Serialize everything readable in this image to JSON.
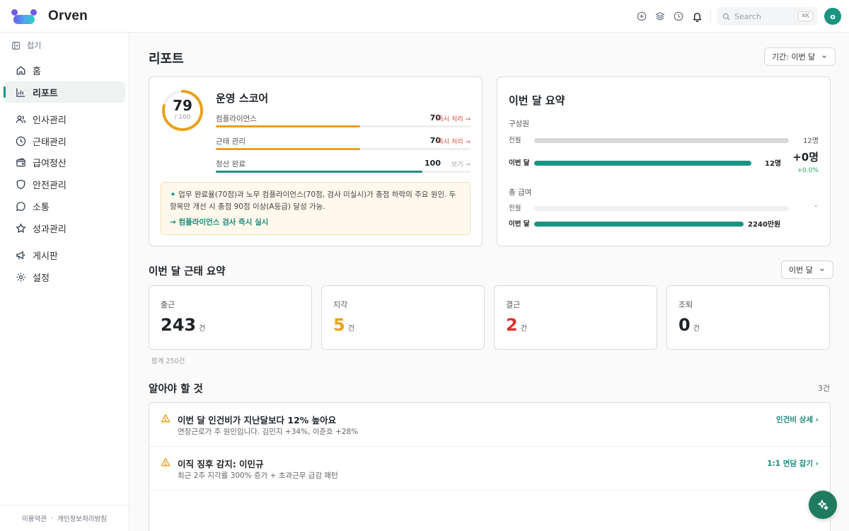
{
  "app": {
    "name": "Orven"
  },
  "topbar": {
    "search_placeholder": "Search",
    "search_shortcut": "⌘K",
    "avatar_initial": "o"
  },
  "sidebar": {
    "collapse_label": "접기",
    "items": [
      {
        "label": "홈",
        "icon": "home-icon"
      },
      {
        "label": "리포트",
        "icon": "bar-chart-icon",
        "active": true
      },
      {
        "label": "인사관리",
        "icon": "users-icon"
      },
      {
        "label": "근태관리",
        "icon": "clock-icon"
      },
      {
        "label": "급여정산",
        "icon": "wallet-icon"
      },
      {
        "label": "안전관리",
        "icon": "shield-icon"
      },
      {
        "label": "소통",
        "icon": "chat-icon"
      },
      {
        "label": "성과관리",
        "icon": "star-icon"
      },
      {
        "label": "게시판",
        "icon": "megaphone-icon"
      },
      {
        "label": "설정",
        "icon": "gear-icon"
      }
    ],
    "footer": {
      "terms": "이용약관",
      "separator": "·",
      "privacy": "개인정보처리방침"
    }
  },
  "page": {
    "title": "리포트",
    "period_select": "기간: 이번 달"
  },
  "score": {
    "value": "79",
    "max_label": "/ 100",
    "value_fraction": 0.79,
    "title": "운영 스코어",
    "metrics": [
      {
        "name": "컴플라이언스",
        "value": "70",
        "percent": 70,
        "link": "즉시 처리 →",
        "color": "#e9a21a"
      },
      {
        "name": "근태 관리",
        "value": "70",
        "percent": 70,
        "link": "즉시 처리 →",
        "color": "#e9a21a"
      },
      {
        "name": "정산 완료",
        "value": "100",
        "percent": 100,
        "link": "보기 →",
        "color": "#1a9483"
      }
    ],
    "insight_icon": "✦",
    "insight": "업무 완료율(70점)과 노무 컴플라이언스(70점, 검사 미실시)가 총점 하락의 주요 원인. 두 항목만 개선 시 총점 90점 이상(A등급) 달성 가능.",
    "insight_link": "→ 컴플라이언스 검사 즉시 실시"
  },
  "summary": {
    "title": "이번 달 요약",
    "headcount": {
      "label": "구성원",
      "prev_label": "전월",
      "prev_value": "12명",
      "curr_label": "이번 달",
      "curr_value": "12명",
      "delta": "+0명",
      "delta_pct": "+0.0%"
    },
    "payroll": {
      "label": "총 급여",
      "prev_label": "전월",
      "prev_value": "-",
      "curr_label": "이번 달",
      "curr_value": "2240만원"
    }
  },
  "attendance": {
    "title": "이번 달 근태 요약",
    "select": "이번 달",
    "stats": [
      {
        "label": "출근",
        "value": "243",
        "unit": "건",
        "color": "#1f2328"
      },
      {
        "label": "지각",
        "value": "5",
        "unit": "건",
        "color": "#e9a21a"
      },
      {
        "label": "결근",
        "value": "2",
        "unit": "건",
        "color": "#d8342c"
      },
      {
        "label": "조퇴",
        "value": "0",
        "unit": "건",
        "color": "#1f2328"
      }
    ],
    "total_note": "합계 250건"
  },
  "notices": {
    "title": "알아야 할 것",
    "count": "3건",
    "items": [
      {
        "title": "이번 달 인건비가 지난달보다 12% 높아요",
        "desc": "연장근로가 주 원인입니다. 김민지 +34%, 이준호 +28%",
        "link": "인건비 상세 ›"
      },
      {
        "title": "이직 징후 감지: 이민규",
        "desc": "최근 2주 지각률 300% 증가 + 초과근무 급감 패턴",
        "link": "1:1 면담 잡기 ›"
      }
    ]
  },
  "colors": {
    "accent": "#1a9483",
    "warning": "#e9a21a",
    "danger": "#d8342c"
  }
}
